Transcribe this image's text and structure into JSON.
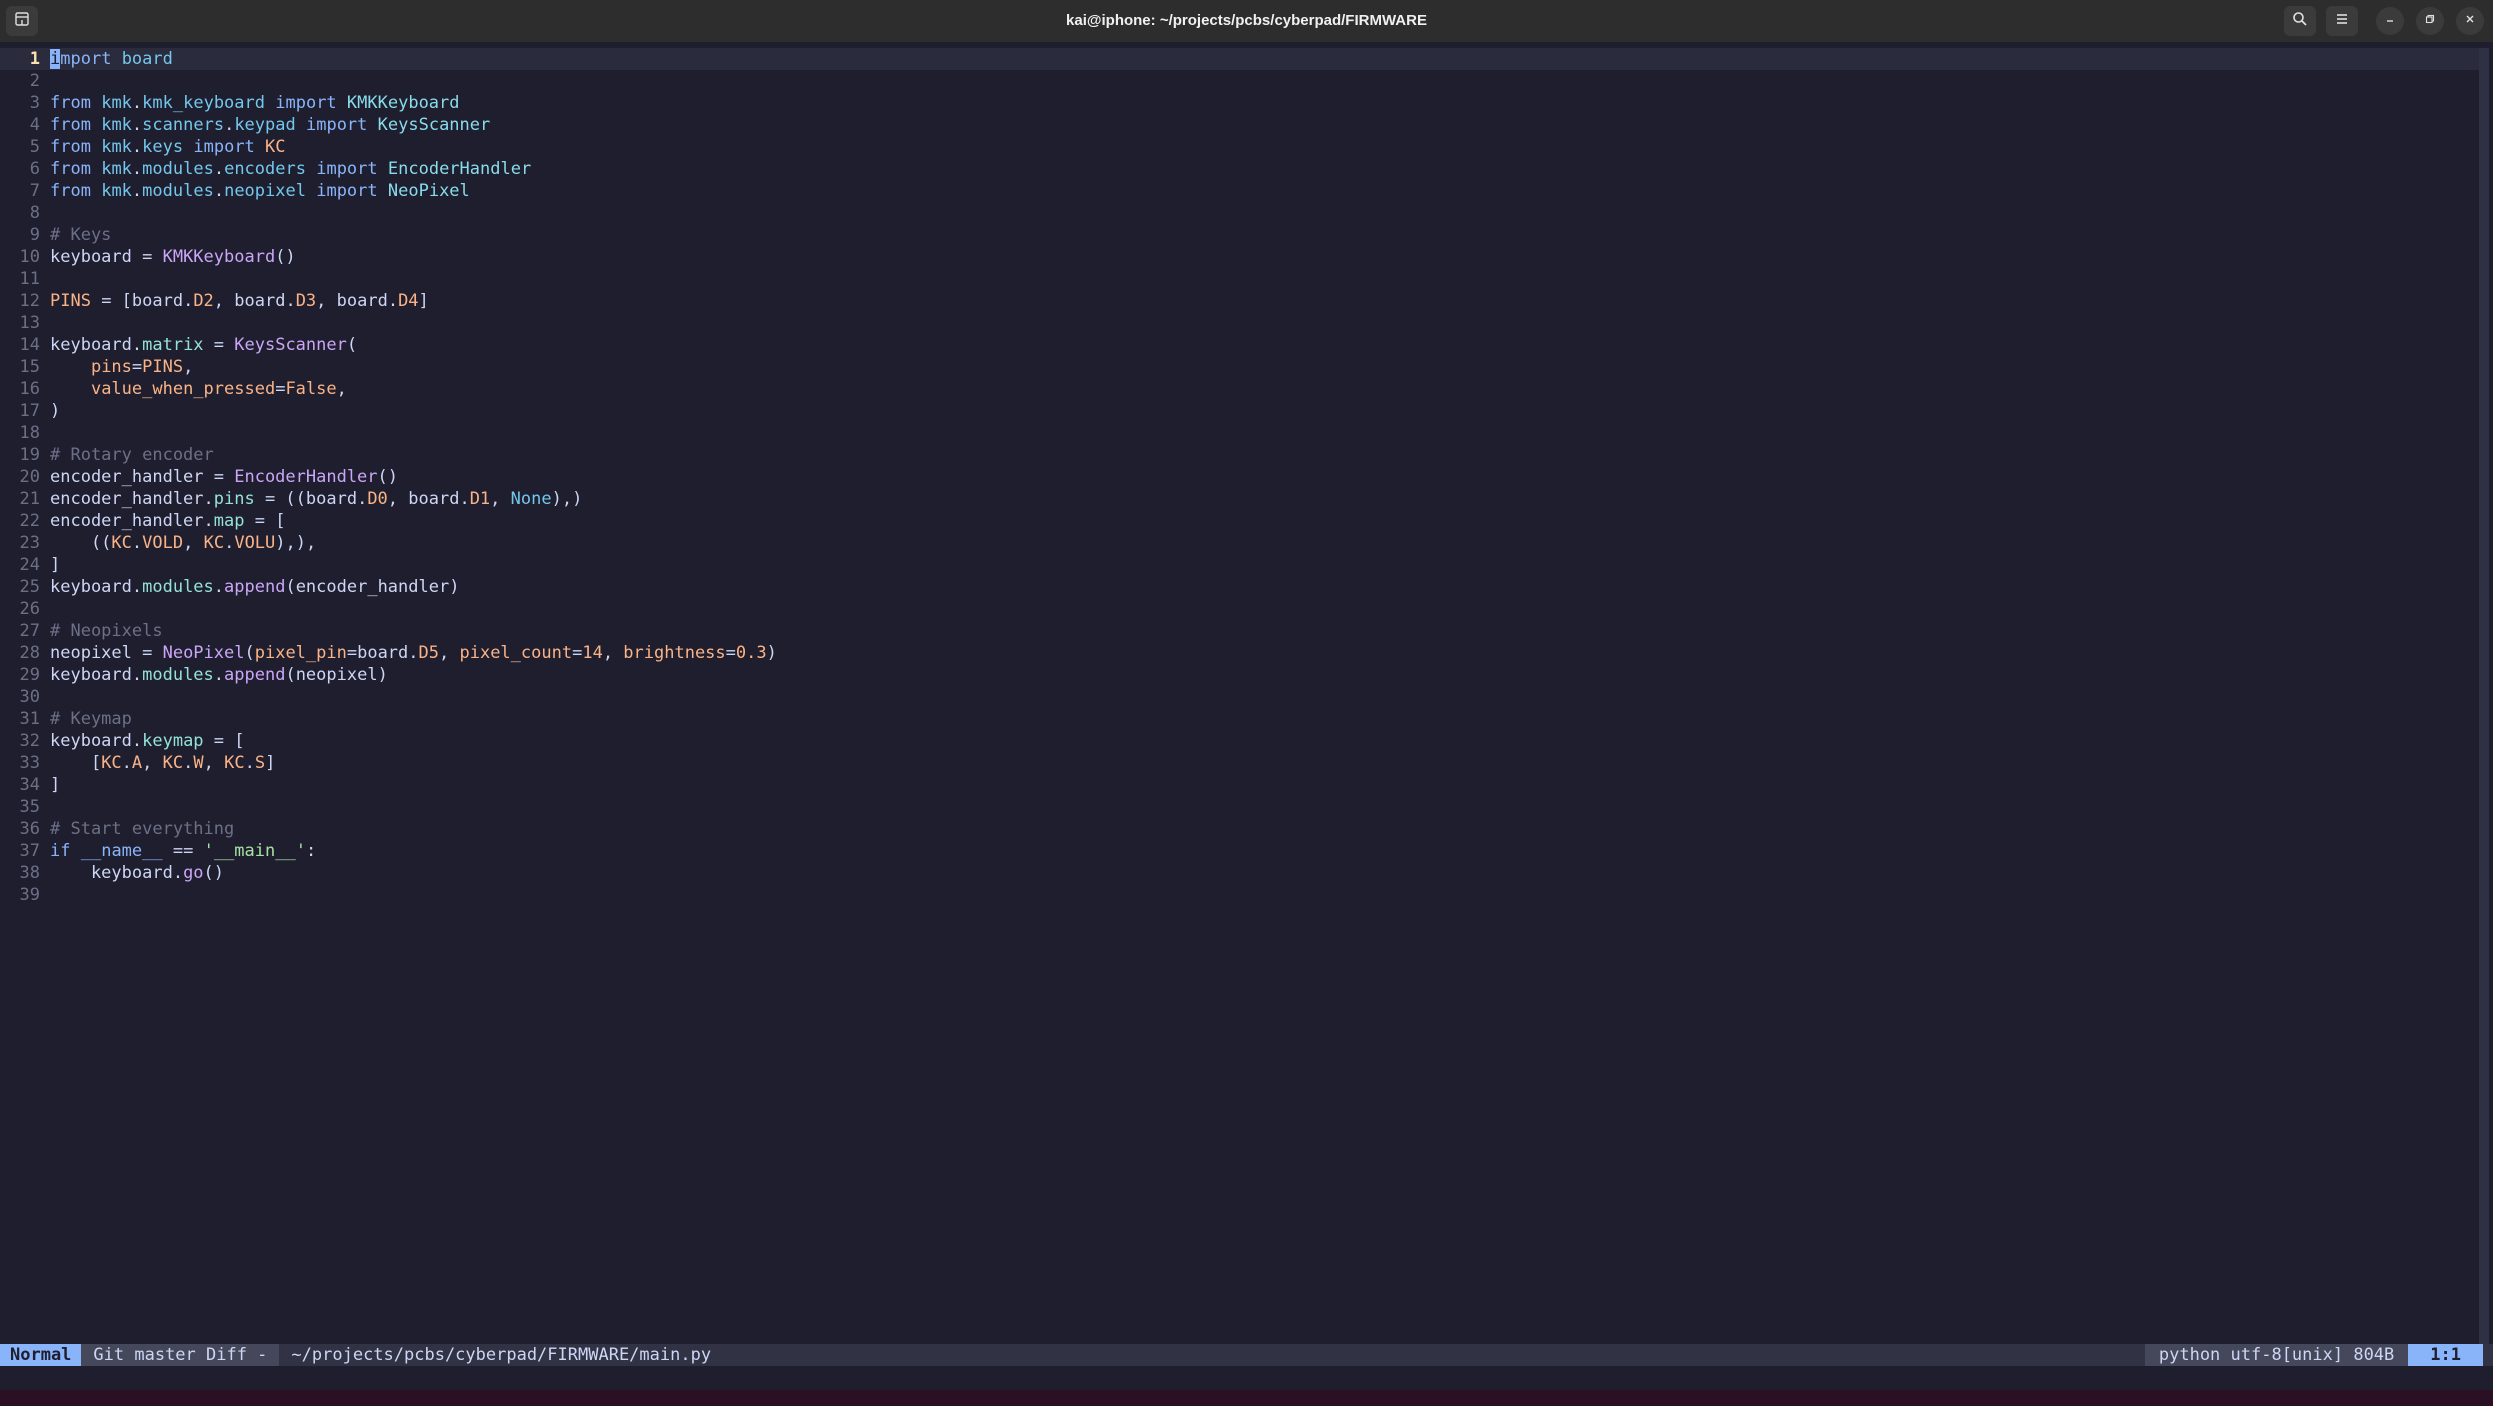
{
  "window": {
    "title": "kai@iphone: ~/projects/pcbs/cyberpad/FIRMWARE",
    "new_tab_icon": "new-tab-icon",
    "search_icon": "search-icon",
    "menu_icon": "hamburger-menu-icon",
    "minimize_icon": "minimize-icon",
    "maximize_icon": "maximize-icon",
    "close_icon": "close-icon"
  },
  "editor": {
    "language": "python",
    "lines": [
      {
        "n": "1",
        "tokens": [
          [
            "cursor",
            "i"
          ],
          [
            "kw",
            "mport"
          ],
          [
            "plain",
            " "
          ],
          [
            "mod",
            "board"
          ]
        ]
      },
      {
        "n": "2",
        "tokens": []
      },
      {
        "n": "3",
        "tokens": [
          [
            "kw",
            "from"
          ],
          [
            "plain",
            " "
          ],
          [
            "mod",
            "kmk"
          ],
          [
            "plain",
            "."
          ],
          [
            "mod",
            "kmk_keyboard"
          ],
          [
            "plain",
            " "
          ],
          [
            "kw",
            "import"
          ],
          [
            "plain",
            " "
          ],
          [
            "cls",
            "KMKKeyboard"
          ]
        ]
      },
      {
        "n": "4",
        "tokens": [
          [
            "kw",
            "from"
          ],
          [
            "plain",
            " "
          ],
          [
            "mod",
            "kmk"
          ],
          [
            "plain",
            "."
          ],
          [
            "mod",
            "scanners"
          ],
          [
            "plain",
            "."
          ],
          [
            "mod",
            "keypad"
          ],
          [
            "plain",
            " "
          ],
          [
            "kw",
            "import"
          ],
          [
            "plain",
            " "
          ],
          [
            "cls",
            "KeysScanner"
          ]
        ]
      },
      {
        "n": "5",
        "tokens": [
          [
            "kw",
            "from"
          ],
          [
            "plain",
            " "
          ],
          [
            "mod",
            "kmk"
          ],
          [
            "plain",
            "."
          ],
          [
            "mod",
            "keys"
          ],
          [
            "plain",
            " "
          ],
          [
            "kw",
            "import"
          ],
          [
            "plain",
            " "
          ],
          [
            "const",
            "KC"
          ]
        ]
      },
      {
        "n": "6",
        "tokens": [
          [
            "kw",
            "from"
          ],
          [
            "plain",
            " "
          ],
          [
            "mod",
            "kmk"
          ],
          [
            "plain",
            "."
          ],
          [
            "mod",
            "modules"
          ],
          [
            "plain",
            "."
          ],
          [
            "mod",
            "encoders"
          ],
          [
            "plain",
            " "
          ],
          [
            "kw",
            "import"
          ],
          [
            "plain",
            " "
          ],
          [
            "cls",
            "EncoderHandler"
          ]
        ]
      },
      {
        "n": "7",
        "tokens": [
          [
            "kw",
            "from"
          ],
          [
            "plain",
            " "
          ],
          [
            "mod",
            "kmk"
          ],
          [
            "plain",
            "."
          ],
          [
            "mod",
            "modules"
          ],
          [
            "plain",
            "."
          ],
          [
            "mod",
            "neopixel"
          ],
          [
            "plain",
            " "
          ],
          [
            "kw",
            "import"
          ],
          [
            "plain",
            " "
          ],
          [
            "cls",
            "NeoPixel"
          ]
        ]
      },
      {
        "n": "8",
        "tokens": []
      },
      {
        "n": "9",
        "tokens": [
          [
            "cmt",
            "# Keys"
          ]
        ]
      },
      {
        "n": "10",
        "tokens": [
          [
            "plain",
            "keyboard = "
          ],
          [
            "fn",
            "KMKKeyboard"
          ],
          [
            "plain",
            "()"
          ]
        ]
      },
      {
        "n": "11",
        "tokens": []
      },
      {
        "n": "12",
        "tokens": [
          [
            "const",
            "PINS"
          ],
          [
            "plain",
            " = [board."
          ],
          [
            "const",
            "D2"
          ],
          [
            "plain",
            ", board."
          ],
          [
            "const",
            "D3"
          ],
          [
            "plain",
            ", board."
          ],
          [
            "const",
            "D4"
          ],
          [
            "plain",
            "]"
          ]
        ]
      },
      {
        "n": "13",
        "tokens": []
      },
      {
        "n": "14",
        "tokens": [
          [
            "plain",
            "keyboard."
          ],
          [
            "attr",
            "matrix"
          ],
          [
            "plain",
            " = "
          ],
          [
            "fn",
            "KeysScanner"
          ],
          [
            "plain",
            "("
          ]
        ]
      },
      {
        "n": "15",
        "tokens": [
          [
            "plain",
            "    "
          ],
          [
            "param",
            "pins"
          ],
          [
            "plain",
            "="
          ],
          [
            "const",
            "PINS"
          ],
          [
            "plain",
            ","
          ]
        ]
      },
      {
        "n": "16",
        "tokens": [
          [
            "plain",
            "    "
          ],
          [
            "param",
            "value_when_pressed"
          ],
          [
            "plain",
            "="
          ],
          [
            "const",
            "False"
          ],
          [
            "plain",
            ","
          ]
        ]
      },
      {
        "n": "17",
        "tokens": [
          [
            "plain",
            ")"
          ]
        ]
      },
      {
        "n": "18",
        "tokens": []
      },
      {
        "n": "19",
        "tokens": [
          [
            "cmt",
            "# Rotary encoder"
          ]
        ]
      },
      {
        "n": "20",
        "tokens": [
          [
            "plain",
            "encoder_handler = "
          ],
          [
            "fn",
            "EncoderHandler"
          ],
          [
            "plain",
            "()"
          ]
        ]
      },
      {
        "n": "21",
        "tokens": [
          [
            "plain",
            "encoder_handler."
          ],
          [
            "attr",
            "pins"
          ],
          [
            "plain",
            " = ((board."
          ],
          [
            "const",
            "D0"
          ],
          [
            "plain",
            ", board."
          ],
          [
            "const",
            "D1"
          ],
          [
            "plain",
            ", "
          ],
          [
            "none",
            "None"
          ],
          [
            "plain",
            "),)"
          ]
        ]
      },
      {
        "n": "22",
        "tokens": [
          [
            "plain",
            "encoder_handler."
          ],
          [
            "attr",
            "map"
          ],
          [
            "plain",
            " = ["
          ]
        ]
      },
      {
        "n": "23",
        "tokens": [
          [
            "plain",
            "    (("
          ],
          [
            "const",
            "KC"
          ],
          [
            "plain",
            "."
          ],
          [
            "const",
            "VOLD"
          ],
          [
            "plain",
            ", "
          ],
          [
            "const",
            "KC"
          ],
          [
            "plain",
            "."
          ],
          [
            "const",
            "VOLU"
          ],
          [
            "plain",
            "),),"
          ]
        ]
      },
      {
        "n": "24",
        "tokens": [
          [
            "plain",
            "]"
          ]
        ]
      },
      {
        "n": "25",
        "tokens": [
          [
            "plain",
            "keyboard."
          ],
          [
            "attr",
            "modules"
          ],
          [
            "plain",
            "."
          ],
          [
            "fn",
            "append"
          ],
          [
            "plain",
            "(encoder_handler)"
          ]
        ]
      },
      {
        "n": "26",
        "tokens": []
      },
      {
        "n": "27",
        "tokens": [
          [
            "cmt",
            "# Neopixels"
          ]
        ]
      },
      {
        "n": "28",
        "tokens": [
          [
            "plain",
            "neopixel = "
          ],
          [
            "fn",
            "NeoPixel"
          ],
          [
            "plain",
            "("
          ],
          [
            "param",
            "pixel_pin"
          ],
          [
            "plain",
            "=board."
          ],
          [
            "const",
            "D5"
          ],
          [
            "plain",
            ", "
          ],
          [
            "param",
            "pixel_count"
          ],
          [
            "plain",
            "="
          ],
          [
            "num",
            "14"
          ],
          [
            "plain",
            ", "
          ],
          [
            "param",
            "brightness"
          ],
          [
            "plain",
            "="
          ],
          [
            "num",
            "0.3"
          ],
          [
            "plain",
            ")"
          ]
        ]
      },
      {
        "n": "29",
        "tokens": [
          [
            "plain",
            "keyboard."
          ],
          [
            "attr",
            "modules"
          ],
          [
            "plain",
            "."
          ],
          [
            "fn",
            "append"
          ],
          [
            "plain",
            "(neopixel)"
          ]
        ]
      },
      {
        "n": "30",
        "tokens": []
      },
      {
        "n": "31",
        "tokens": [
          [
            "cmt",
            "# Keymap"
          ]
        ]
      },
      {
        "n": "32",
        "tokens": [
          [
            "plain",
            "keyboard."
          ],
          [
            "attr",
            "keymap"
          ],
          [
            "plain",
            " = ["
          ]
        ]
      },
      {
        "n": "33",
        "tokens": [
          [
            "plain",
            "    ["
          ],
          [
            "const",
            "KC"
          ],
          [
            "plain",
            "."
          ],
          [
            "const",
            "A"
          ],
          [
            "plain",
            ", "
          ],
          [
            "const",
            "KC"
          ],
          [
            "plain",
            "."
          ],
          [
            "const",
            "W"
          ],
          [
            "plain",
            ", "
          ],
          [
            "const",
            "KC"
          ],
          [
            "plain",
            "."
          ],
          [
            "const",
            "S"
          ],
          [
            "plain",
            "]"
          ]
        ]
      },
      {
        "n": "34",
        "tokens": [
          [
            "plain",
            "]"
          ]
        ]
      },
      {
        "n": "35",
        "tokens": []
      },
      {
        "n": "36",
        "tokens": [
          [
            "cmt",
            "# Start everything"
          ]
        ]
      },
      {
        "n": "37",
        "tokens": [
          [
            "kw",
            "if"
          ],
          [
            "plain",
            " "
          ],
          [
            "dunder",
            "__name__"
          ],
          [
            "plain",
            " == "
          ],
          [
            "str",
            "'__main__'"
          ],
          [
            "plain",
            ":"
          ]
        ]
      },
      {
        "n": "38",
        "tokens": [
          [
            "plain",
            "    keyboard."
          ],
          [
            "fn",
            "go"
          ],
          [
            "plain",
            "()"
          ]
        ]
      },
      {
        "n": "39",
        "tokens": []
      }
    ]
  },
  "statusline": {
    "mode": "Normal",
    "git": "Git master Diff -",
    "filename": "~/projects/pcbs/cyberpad/FIRMWARE/main.py",
    "filetype": "python utf-8[unix] 804B",
    "position": "1:1"
  }
}
